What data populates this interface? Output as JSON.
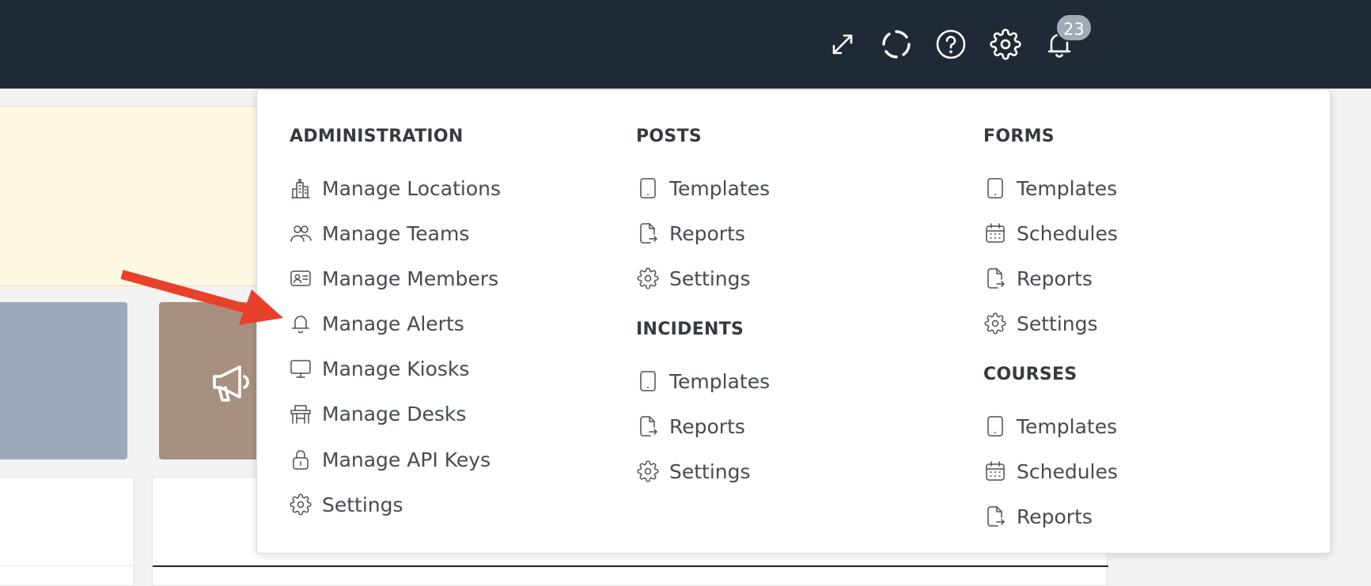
{
  "header": {
    "notification_count": "23"
  },
  "icons": {
    "expand": "expand-icon",
    "loading": "loading-ring-icon",
    "help": "help-icon",
    "settings": "gear-icon",
    "notifications": "bell-icon"
  },
  "colors": {
    "topbar": "#202a36",
    "badge": "#a3aab4",
    "notice": "#fff9e4",
    "tile_grey": "#9ba9bb",
    "tile_brown": "#a7907f",
    "arrow": "#e8412b"
  },
  "menu": {
    "administration": {
      "title": "ADMINISTRATION",
      "items": [
        {
          "label": "Manage Locations",
          "icon": "building-icon"
        },
        {
          "label": "Manage Teams",
          "icon": "team-icon"
        },
        {
          "label": "Manage Members",
          "icon": "member-card-icon"
        },
        {
          "label": "Manage Alerts",
          "icon": "bell-icon"
        },
        {
          "label": "Manage Kiosks",
          "icon": "monitor-icon"
        },
        {
          "label": "Manage Desks",
          "icon": "desk-icon"
        },
        {
          "label": "Manage API Keys",
          "icon": "lock-icon"
        },
        {
          "label": "Settings",
          "icon": "gear-icon"
        }
      ]
    },
    "posts": {
      "title": "POSTS",
      "items": [
        {
          "label": "Templates",
          "icon": "tablet-icon"
        },
        {
          "label": "Reports",
          "icon": "report-icon"
        },
        {
          "label": "Settings",
          "icon": "gear-icon"
        }
      ]
    },
    "incidents": {
      "title": "INCIDENTS",
      "items": [
        {
          "label": "Templates",
          "icon": "tablet-icon"
        },
        {
          "label": "Reports",
          "icon": "report-icon"
        },
        {
          "label": "Settings",
          "icon": "gear-icon"
        }
      ]
    },
    "forms": {
      "title": "FORMS",
      "items": [
        {
          "label": "Templates",
          "icon": "tablet-icon"
        },
        {
          "label": "Schedules",
          "icon": "calendar-icon"
        },
        {
          "label": "Reports",
          "icon": "report-icon"
        },
        {
          "label": "Settings",
          "icon": "gear-icon"
        }
      ]
    },
    "courses": {
      "title": "COURSES",
      "items": [
        {
          "label": "Templates",
          "icon": "tablet-icon"
        },
        {
          "label": "Schedules",
          "icon": "calendar-icon"
        },
        {
          "label": "Reports",
          "icon": "report-icon"
        }
      ]
    }
  }
}
